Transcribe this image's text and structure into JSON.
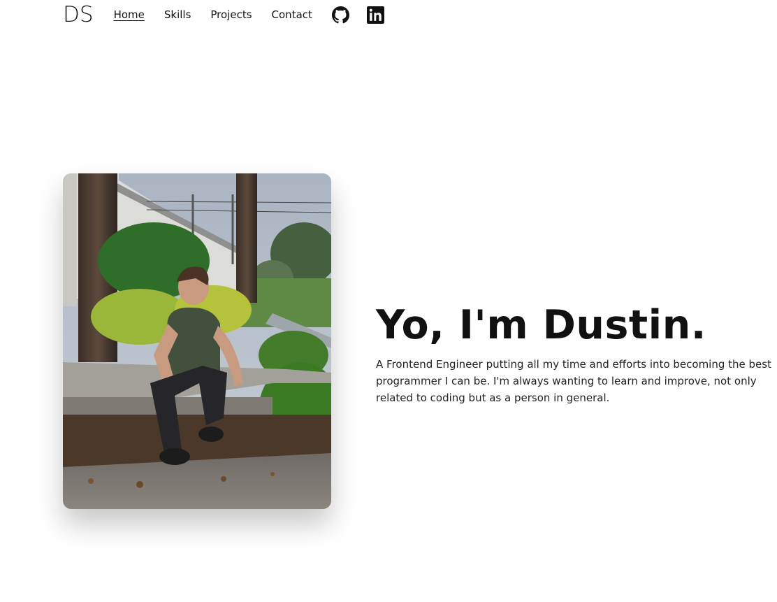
{
  "nav": {
    "logo": "DS",
    "links": [
      {
        "label": "Home",
        "active": true
      },
      {
        "label": "Skills",
        "active": false
      },
      {
        "label": "Projects",
        "active": false
      },
      {
        "label": "Contact",
        "active": false
      }
    ],
    "icons": [
      "github-icon",
      "linkedin-icon"
    ]
  },
  "hero": {
    "title": "Yo, I'm Dustin.",
    "description": "A Frontend Engineer putting all my time and efforts into becoming the best programmer I can be. I'm always wanting to learn and improve, not only related to coding but as a person in general."
  },
  "colors": {
    "text": "#111111",
    "background": "#ffffff"
  }
}
